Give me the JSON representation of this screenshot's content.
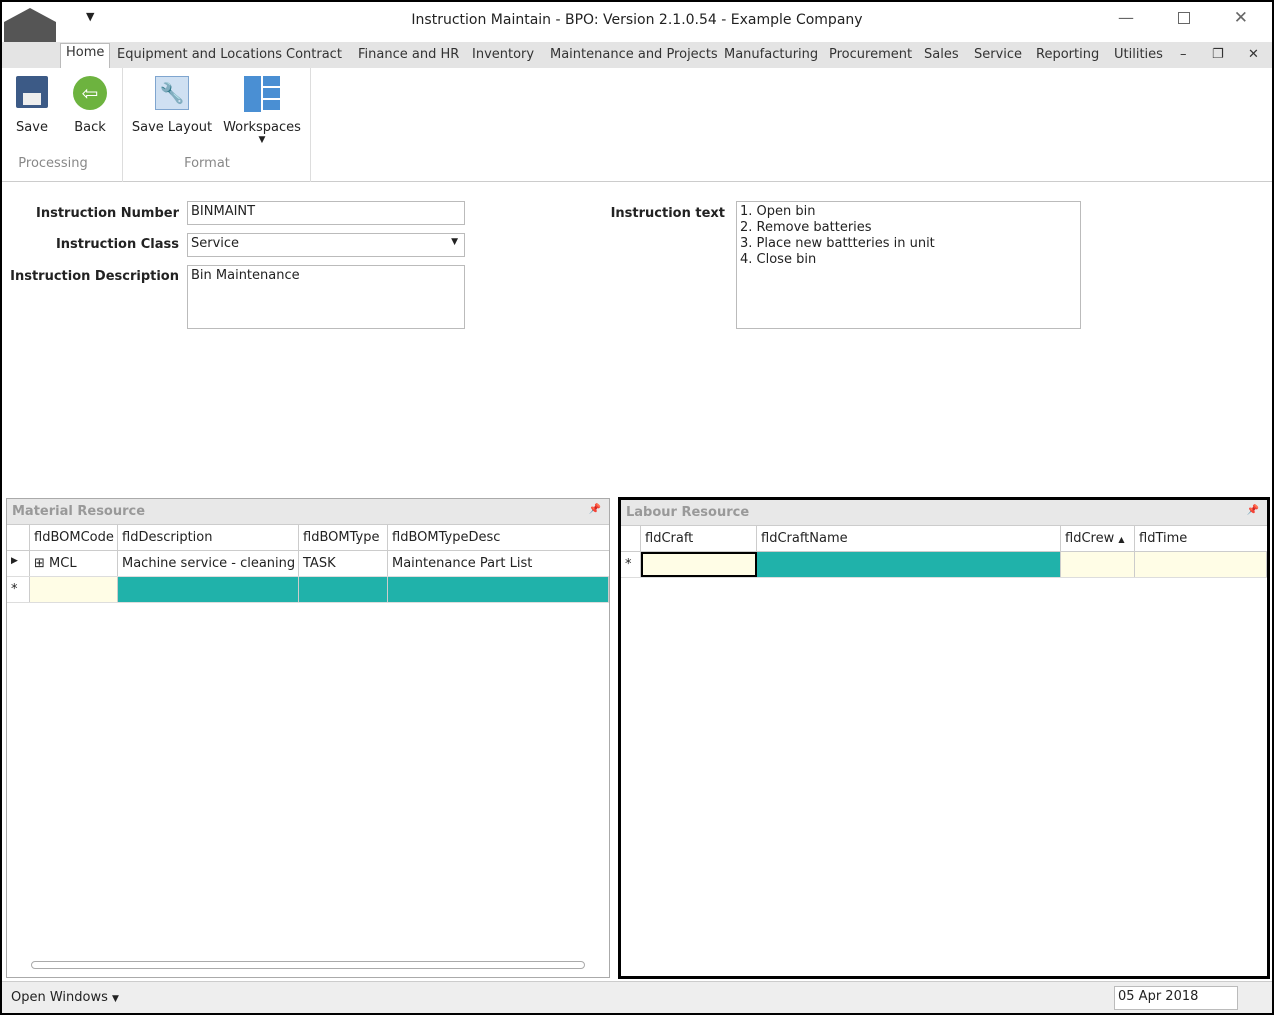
{
  "window": {
    "title": "Instruction Maintain - BPO: Version 2.1.0.54 - Example Company",
    "logo": "bpo"
  },
  "tabs": [
    "Home",
    "Equipment and Locations",
    "Contract",
    "Finance and HR",
    "Inventory",
    "Maintenance and Projects",
    "Manufacturing",
    "Procurement",
    "Sales",
    "Service",
    "Reporting",
    "Utilities"
  ],
  "ribbon": {
    "save": "Save",
    "back": "Back",
    "save_layout": "Save Layout",
    "workspaces": "Workspaces",
    "group_processing": "Processing",
    "group_format": "Format"
  },
  "form": {
    "number_label": "Instruction Number",
    "number_value": "BINMAINT",
    "class_label": "Instruction Class",
    "class_value": "Service",
    "desc_label": "Instruction Description",
    "desc_value": "Bin Maintenance",
    "text_label": "Instruction text",
    "text_lines": [
      "1. Open bin",
      "2. Remove batteries",
      "3. Place new battteries in unit",
      "4. Close bin"
    ]
  },
  "material": {
    "title": "Material Resource",
    "columns": [
      "fldBOMCode",
      "fldDescription",
      "fldBOMType",
      "fldBOMTypeDesc"
    ],
    "rows": [
      [
        "MCL",
        "Machine service - cleaning",
        "TASK",
        "Maintenance Part List"
      ]
    ]
  },
  "labour": {
    "title": "Labour Resource",
    "columns": [
      "fldCraft",
      "fldCraftName",
      "fldCrew",
      "fldTime"
    ]
  },
  "status": {
    "open_windows": "Open Windows",
    "date": "05 Apr 2018"
  }
}
